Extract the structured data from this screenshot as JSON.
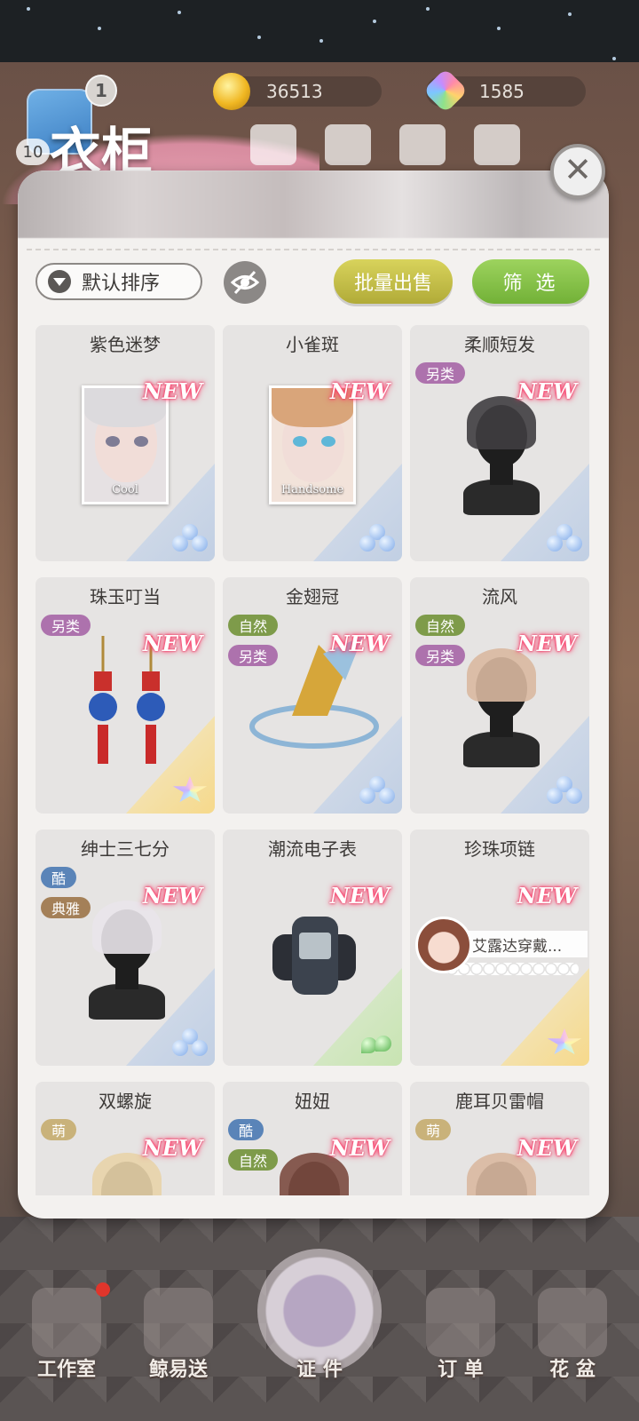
{
  "hud": {
    "level_badge": "1",
    "player_level": "10",
    "coins": "36513",
    "gems": "1585",
    "title": "衣柜"
  },
  "toolbar": {
    "sort_label": "默认排序",
    "bulk_sell_label": "批量出售",
    "filter_label": "筛 选",
    "close_label": "✕"
  },
  "items": [
    {
      "name": "紫色迷梦",
      "new": "NEW",
      "kind": "portrait",
      "caption": "Cool",
      "tags": [],
      "rarity": "blue"
    },
    {
      "name": "小雀斑",
      "new": "NEW",
      "kind": "portrait",
      "caption": "Handsome",
      "tags": [],
      "rarity": "blue"
    },
    {
      "name": "柔顺短发",
      "new": "NEW",
      "kind": "hair",
      "tags": [
        "另类"
      ],
      "rarity": "blue"
    },
    {
      "name": "珠玉叮当",
      "new": "NEW",
      "kind": "earrings",
      "tags": [
        "另类"
      ],
      "rarity": "gold"
    },
    {
      "name": "金翅冠",
      "new": "NEW",
      "kind": "crown",
      "tags": [
        "自然",
        "另类"
      ],
      "rarity": "blue"
    },
    {
      "name": "流风",
      "new": "NEW",
      "kind": "hair",
      "tags": [
        "自然",
        "另类"
      ],
      "rarity": "blue"
    },
    {
      "name": "绅士三七分",
      "new": "NEW",
      "kind": "hair",
      "tags": [
        "酷",
        "典雅"
      ],
      "rarity": "blue"
    },
    {
      "name": "潮流电子表",
      "new": "NEW",
      "kind": "watch",
      "tags": [],
      "rarity": "green"
    },
    {
      "name": "珍珠项链",
      "new": "NEW",
      "kind": "necklace",
      "wearer": "艾露达穿戴...",
      "tags": [],
      "rarity": "gold"
    },
    {
      "name": "双螺旋",
      "new": "NEW",
      "kind": "hair",
      "tags": [
        "萌"
      ],
      "rarity": "blue"
    },
    {
      "name": "妞妞",
      "new": "NEW",
      "kind": "hair",
      "tags": [
        "酷",
        "自然"
      ],
      "rarity": "blue"
    },
    {
      "name": "鹿耳贝雷帽",
      "new": "NEW",
      "kind": "hat",
      "tags": [
        "萌"
      ],
      "rarity": "blue"
    }
  ],
  "bottom_nav": [
    {
      "label": "工作室",
      "icon": "workshop-icon",
      "badge": true
    },
    {
      "label": "鲸易送",
      "icon": "delivery-icon",
      "badge": false
    },
    {
      "label": "证 件",
      "icon": "certificate-icon",
      "badge": false
    },
    {
      "label": "订 单",
      "icon": "order-icon",
      "badge": false
    },
    {
      "label": "花 盆",
      "icon": "flowerpot-icon",
      "badge": false
    }
  ],
  "colors": {
    "accent_yellow": "#c9c44a",
    "accent_green": "#86c24a",
    "new_glow": "#ff3c6a"
  }
}
